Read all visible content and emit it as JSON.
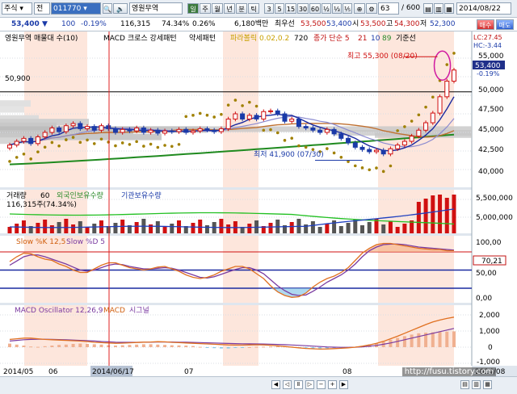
{
  "toolbar": {
    "market": "주식",
    "mode": "전",
    "code": "011770",
    "name": "영원무역",
    "periods": [
      "일",
      "주",
      "월",
      "년",
      "분",
      "틱"
    ],
    "minutes": [
      "3",
      "5",
      "15",
      "30",
      "60",
      "½",
      "⅓",
      "⅕"
    ],
    "count": "63",
    "total": "/ 600",
    "date": "2014/08/22"
  },
  "infobar": {
    "price": "53,400",
    "change": "100",
    "change_pct": "-0.19%",
    "volume": "116,315",
    "turnover_pct": "74.34%",
    "ratio": "0.26%",
    "amount": "6,180백만",
    "items": [
      "최우선",
      "53,500",
      "53,400",
      "시",
      "53,500",
      "고",
      "54,300",
      "저",
      "52,300"
    ]
  },
  "price_panel": {
    "legend": [
      "영원무역 매물대 수(10)",
      "MACD 크로스 강세패턴",
      "약세패턴",
      "파라볼릭 0.02,0.2",
      "720",
      "종가 단순 5",
      "21",
      "10",
      "89",
      "기준선"
    ],
    "lc": "LC:27.45",
    "hc": "HC:-3.44",
    "y_ticks": [
      "55,000",
      "50,000",
      "47,500",
      "45,000",
      "42,500",
      "40,000"
    ],
    "current_price_label": "53,400",
    "current_pct_label": "-0.19%",
    "ref_line_label": "50,900",
    "high_annotation": "최고 55,300 (08/20)",
    "low_annotation": "최저 41,900 (07/30)"
  },
  "volume_panel": {
    "legend": [
      "거래량",
      "60",
      "외국인보유수량",
      "기관보유수량"
    ],
    "sub": "116,315주(74.34%)",
    "y_ticks": [
      "5,500,000",
      "5,000,000"
    ]
  },
  "stoch_panel": {
    "legend": [
      "Slow %K 12,5",
      "Slow %D 5"
    ],
    "y_ticks": [
      "100,00",
      "50,00",
      "0,00"
    ],
    "current_label": "70,21"
  },
  "macd_panel": {
    "legend": [
      "MACD Oscillator 12,26,9",
      "MACD",
      "시그널"
    ],
    "y_ticks": [
      "2,000",
      "1,000",
      "0",
      "-1,000"
    ]
  },
  "x_axis": {
    "labels": [
      "2014/05",
      "06",
      "2014/06/17",
      "07",
      "08",
      "2014/08"
    ]
  },
  "watermark": "http://fusu.tistory.com",
  "chart_data": {
    "type": "line",
    "title": "영원무역",
    "x_labels": [
      "2014/05",
      "06",
      "07",
      "08"
    ],
    "price_range": [
      38500,
      56500
    ],
    "close": [
      43300,
      43800,
      44200,
      43500,
      44400,
      45000,
      45600,
      45100,
      45900,
      46200,
      45500,
      45800,
      45300,
      45900,
      45500,
      45000,
      45400,
      45200,
      45600,
      45000,
      45300,
      44900,
      45200,
      45100,
      45400,
      45000,
      45200,
      45500,
      45300,
      45100,
      45500,
      46800,
      47500,
      46800,
      47300,
      46800,
      47800,
      47900,
      47500,
      46500,
      46800,
      45800,
      45600,
      45300,
      45000,
      45400,
      44800,
      44200,
      43600,
      43000,
      42700,
      42400,
      42600,
      42100,
      42800,
      43300,
      43800,
      44500,
      45300,
      46300,
      47600,
      49800,
      51900,
      53400
    ],
    "high_point": {
      "label": "최고",
      "value": 55300,
      "date": "08/20"
    },
    "low_point": {
      "label": "최저",
      "value": 41900,
      "date": "07/30"
    },
    "ma_long_start": 40700,
    "ma_long_end": 44700,
    "volume_series": [
      {
        "name": "외국인보유수량"
      },
      {
        "name": "기관보유수량"
      }
    ],
    "volume_last_values": [
      5400000,
      5100000
    ],
    "stoch_k": [
      64,
      72,
      78,
      77,
      72,
      68,
      66,
      60,
      56,
      50,
      46,
      46,
      52,
      58,
      62,
      62,
      58,
      54,
      52,
      50,
      52,
      55,
      56,
      52,
      48,
      42,
      38,
      36,
      38,
      42,
      48,
      52,
      56,
      56,
      52,
      44,
      36,
      24,
      14,
      8,
      5,
      6,
      12,
      22,
      30,
      36,
      40,
      46,
      54,
      66,
      78,
      86,
      92,
      94,
      94,
      92,
      90,
      88,
      86,
      85,
      84,
      84,
      82,
      82
    ],
    "stoch_d": [
      58,
      65,
      72,
      75,
      75,
      72,
      68,
      64,
      60,
      55,
      50,
      48,
      50,
      54,
      58,
      60,
      59,
      56,
      54,
      52,
      52,
      53,
      54,
      53,
      50,
      46,
      42,
      38,
      37,
      39,
      43,
      47,
      51,
      54,
      54,
      50,
      44,
      34,
      24,
      16,
      10,
      8,
      9,
      15,
      22,
      30,
      36,
      42,
      50,
      60,
      72,
      82,
      88,
      92,
      93,
      93,
      92,
      90,
      88,
      87,
      86,
      85,
      84,
      83
    ],
    "stoch_current": 70.21,
    "macd_osc": [
      220,
      160,
      100,
      40,
      20,
      60,
      100,
      140,
      160,
      200,
      220,
      200,
      180,
      160,
      120,
      100,
      120,
      140,
      160,
      180,
      180,
      160,
      140,
      120,
      110,
      100,
      70,
      20,
      -30,
      -60,
      -80,
      -80,
      -50,
      -20,
      0,
      20,
      30,
      40,
      50,
      60,
      40,
      -20,
      -60,
      -80,
      -80,
      -70,
      -50,
      -40,
      -20,
      20,
      80,
      150,
      240,
      330,
      460,
      570,
      680,
      780,
      860,
      900,
      920,
      940,
      960,
      980
    ],
    "macd": [
      480,
      520,
      560,
      560,
      520,
      480,
      460,
      440,
      420,
      400,
      380,
      350,
      300,
      280,
      260,
      240,
      250,
      270,
      290,
      310,
      320,
      340,
      330,
      300,
      280,
      260,
      240,
      220,
      200,
      180,
      160,
      140,
      130,
      130,
      140,
      150,
      140,
      120,
      80,
      40,
      0,
      -40,
      -80,
      -100,
      -120,
      -110,
      -90,
      -70,
      -40,
      0,
      60,
      140,
      240,
      360,
      520,
      680,
      860,
      1040,
      1220,
      1400,
      1560,
      1680,
      1780,
      1860
    ],
    "macd_signal": [
      380,
      420,
      460,
      480,
      490,
      490,
      480,
      470,
      460,
      440,
      420,
      400,
      380,
      350,
      330,
      310,
      300,
      300,
      300,
      305,
      310,
      315,
      320,
      318,
      312,
      305,
      295,
      285,
      272,
      260,
      245,
      230,
      220,
      210,
      205,
      200,
      195,
      185,
      170,
      155,
      135,
      115,
      90,
      65,
      40,
      15,
      0,
      -10,
      -10,
      0,
      20,
      60,
      110,
      180,
      260,
      360,
      460,
      560,
      660,
      760,
      860,
      960,
      1060,
      1160
    ]
  }
}
